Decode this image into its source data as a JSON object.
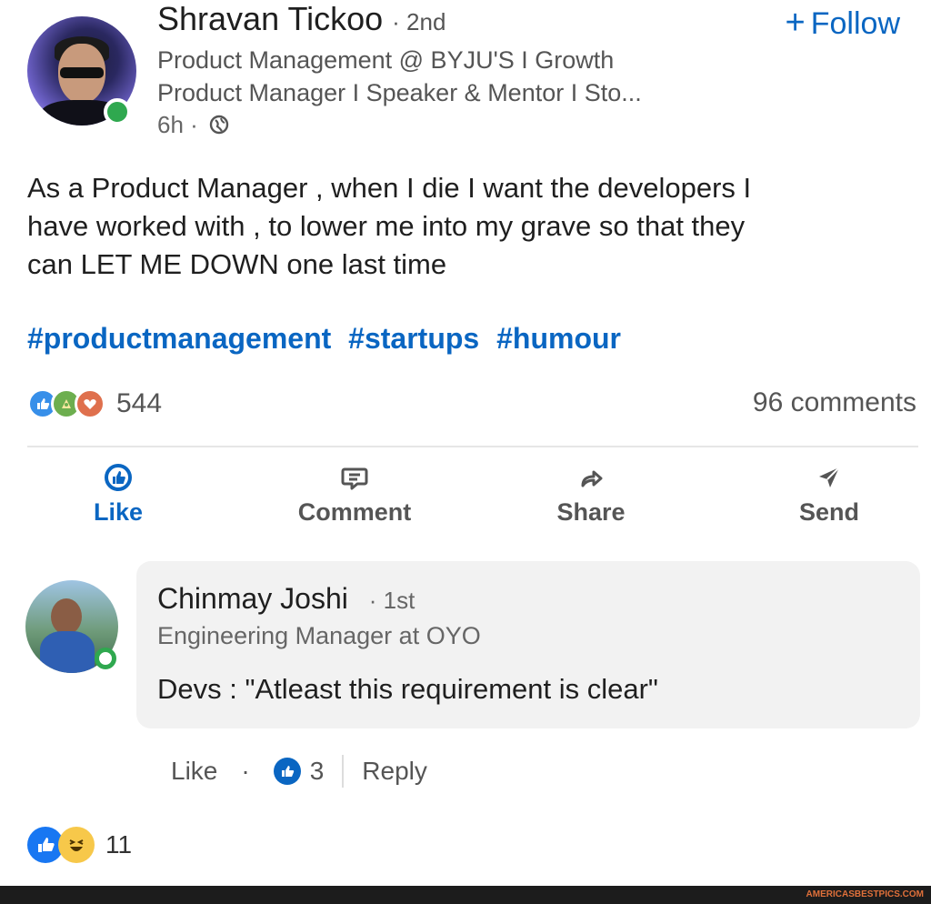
{
  "post": {
    "author_name": "Shravan Tickoo",
    "connection_degree": "· 2nd",
    "headline_line1": "Product Management @ BYJU'S I Growth",
    "headline_line2": "Product Manager I Speaker & Mentor I Sto...",
    "time": "6h ·",
    "follow_label": "Follow",
    "follow_plus": "+",
    "text_line1": "As a Product Manager , when I die I want the developers I",
    "text_line2": "have worked with , to lower me into my grave so that they",
    "text_line3": "can LET ME DOWN one last time",
    "hashtags": [
      "#productmanagement",
      "#startups",
      "#humour"
    ],
    "reaction_count": "544",
    "comments_count": "96 comments"
  },
  "actions": {
    "like": "Like",
    "comment": "Comment",
    "share": "Share",
    "send": "Send"
  },
  "comment": {
    "name": "Chinmay Joshi",
    "degree": "· 1st",
    "headline": "Engineering Manager at OYO",
    "text": "Devs : \"Atleast this requirement is clear\"",
    "like_label": "Like",
    "dot": "·",
    "like_count": "3",
    "reply_label": "Reply"
  },
  "bottom": {
    "reaction_count": "11"
  },
  "watermark": "AMERICASBESTPICS.COM",
  "colors": {
    "accent": "#0a66c2",
    "online": "#2fa84f",
    "comment_bg": "#f2f2f2"
  },
  "icons": [
    "globe-icon",
    "like-icon",
    "comment-icon",
    "share-icon",
    "send-icon",
    "celebrate-icon",
    "love-icon",
    "haha-icon"
  ]
}
